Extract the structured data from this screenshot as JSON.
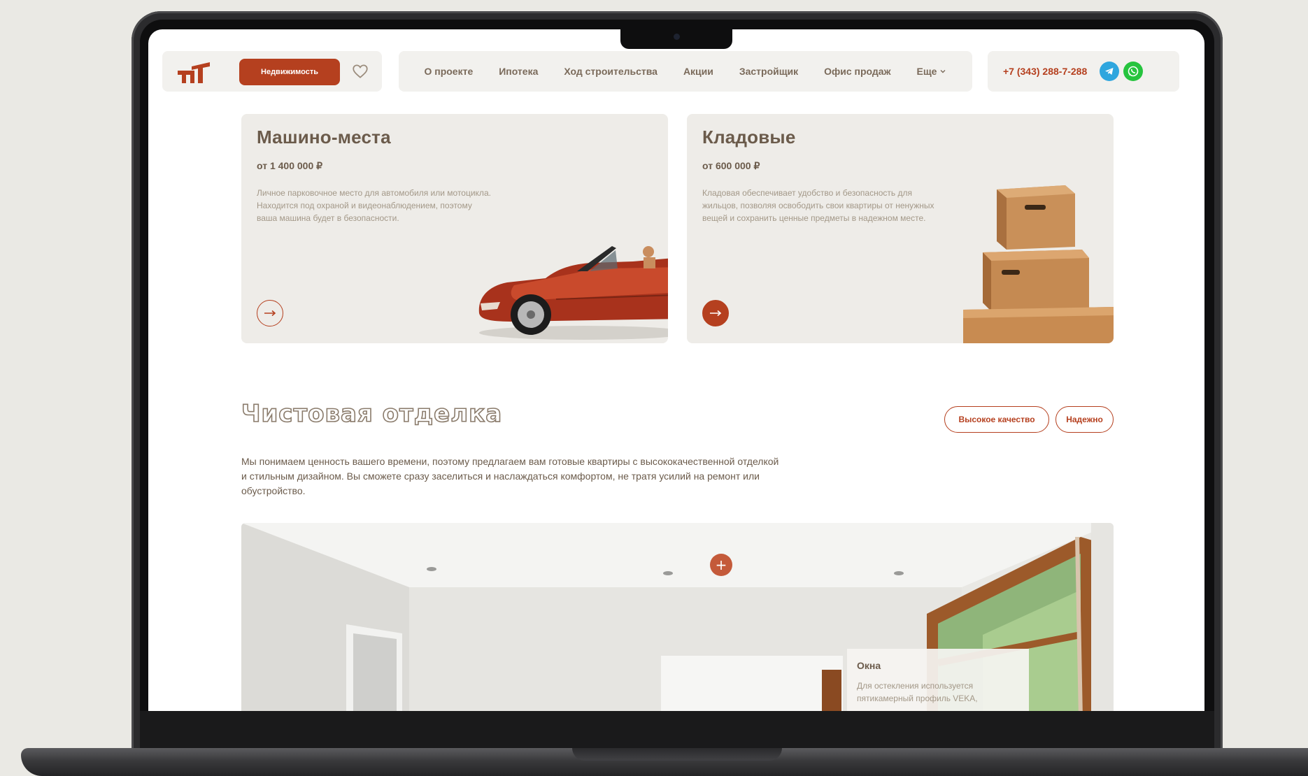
{
  "header": {
    "estate_button": "Недвижимость",
    "nav": [
      "О проекте",
      "Ипотека",
      "Ход строительства",
      "Акции",
      "Застройщик",
      "Офис продаж"
    ],
    "more": "Еще",
    "phone": "+7 (343) 288-7-288"
  },
  "cards": [
    {
      "title": "Машино-места",
      "price": "от 1 400 000 ₽",
      "desc": "Личное парковочное место для автомобиля или мотоцикла. Находится под охраной и видеонаблюдением, поэтому ваша машина будет в безопасности."
    },
    {
      "title": "Кладовые",
      "price": "от 600 000 ₽",
      "desc": "Кладовая обеспечивает удобство и безопасность для жильцов, позволяя освободить свои квартиры от ненужных вещей и сохранить ценные предметы в надежном месте."
    }
  ],
  "finishing": {
    "title": "Чистовая отделка",
    "tags": [
      "Высокое качество",
      "Надежно"
    ],
    "desc": "Мы понимаем ценность вашего времени, поэтому предлагаем вам готовые квартиры с высококачественной отделкой и стильным дизайном. Вы сможете сразу заселиться и наслаждаться комфортом, не тратя усилий на ремонт или обустройство.",
    "pin_symbol": "+",
    "tooltip": {
      "title": "Окна",
      "text": "Для остекления используется пятикамерный профиль VEKA,"
    }
  },
  "colors": {
    "accent": "#b5401f",
    "text_brown": "#6b5b4b",
    "card_bg": "#eeece8",
    "telegram": "#2fa6de",
    "whatsapp": "#26c43e"
  },
  "icons": [
    "logo-mark",
    "heart-icon",
    "chevron-down-icon",
    "telegram-icon",
    "whatsapp-icon",
    "arrow-right-icon",
    "plus-icon"
  ]
}
